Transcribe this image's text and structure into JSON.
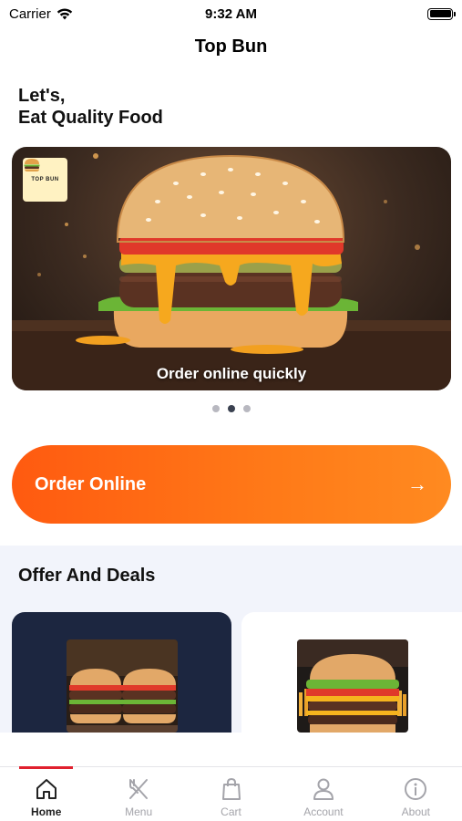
{
  "status_bar": {
    "carrier": "Carrier",
    "time": "9:32 AM"
  },
  "nav": {
    "title": "Top Bun"
  },
  "headline": {
    "line1": "Let's,",
    "line2": "Eat Quality Food"
  },
  "hero": {
    "logo_text": "TOP BUN",
    "caption": "Order online quickly",
    "slide_count": 3,
    "active_slide": 2
  },
  "cta": {
    "label": "Order Online",
    "arrow": "→"
  },
  "offers": {
    "title": "Offer And Deals"
  },
  "tabbar": {
    "items": [
      {
        "label": "Home",
        "icon": "home-icon",
        "active": true
      },
      {
        "label": "Menu",
        "icon": "fork-knife-icon",
        "active": false
      },
      {
        "label": "Cart",
        "icon": "shopping-bag-icon",
        "active": false
      },
      {
        "label": "Account",
        "icon": "person-icon",
        "active": false
      },
      {
        "label": "About",
        "icon": "info-icon",
        "active": false
      }
    ]
  },
  "colors": {
    "accent": "#ff6a14",
    "active_tab_indicator": "#e0202e",
    "offer_card_dark": "#1c2640",
    "section_bg": "#f2f4fb"
  }
}
